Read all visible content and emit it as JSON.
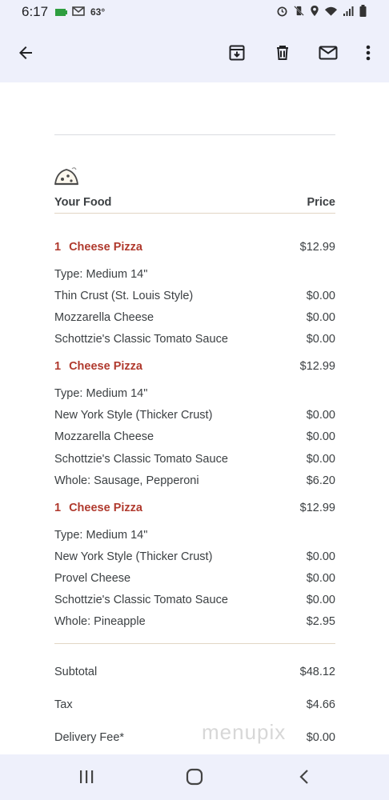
{
  "status_bar": {
    "time": "6:17",
    "temperature": "63°",
    "left_icons": [
      "battery-saver-icon",
      "mail-notification-icon"
    ],
    "right_icons": [
      "alarm-icon",
      "vibrate-off-icon",
      "location-icon",
      "wifi-icon",
      "signal-icon",
      "battery-icon"
    ]
  },
  "app_bar": {
    "actions": [
      "back-arrow-icon",
      "archive-icon",
      "delete-icon",
      "mark-unread-icon",
      "more-vert-icon"
    ]
  },
  "receipt": {
    "header": {
      "food_label": "Your Food",
      "price_label": "Price"
    },
    "items": [
      {
        "qty": "1",
        "name": "Cheese Pizza",
        "price": "$12.99",
        "type": "Type: Medium 14\"",
        "options": [
          {
            "label": "Thin Crust (St. Louis Style)",
            "price": "$0.00"
          },
          {
            "label": "Mozzarella Cheese",
            "price": "$0.00"
          },
          {
            "label": "Schottzie's Classic Tomato Sauce",
            "price": "$0.00"
          }
        ]
      },
      {
        "qty": "1",
        "name": "Cheese Pizza",
        "price": "$12.99",
        "type": "Type: Medium 14\"",
        "options": [
          {
            "label": "New York Style (Thicker Crust)",
            "price": "$0.00"
          },
          {
            "label": "Mozzarella Cheese",
            "price": "$0.00"
          },
          {
            "label": "Schottzie's Classic Tomato Sauce",
            "price": "$0.00"
          },
          {
            "label": "Whole: Sausage, Pepperoni",
            "price": "$6.20"
          }
        ]
      },
      {
        "qty": "1",
        "name": "Cheese Pizza",
        "price": "$12.99",
        "type": "Type: Medium 14\"",
        "options": [
          {
            "label": "New York Style (Thicker Crust)",
            "price": "$0.00"
          },
          {
            "label": "Provel Cheese",
            "price": "$0.00"
          },
          {
            "label": "Schottzie's Classic Tomato Sauce",
            "price": "$0.00"
          },
          {
            "label": "Whole: Pineapple",
            "price": "$2.95"
          }
        ]
      }
    ],
    "totals": [
      {
        "label": "Subtotal",
        "value": "$48.12"
      },
      {
        "label": "Tax",
        "value": "$4.66"
      },
      {
        "label": "Delivery Fee*",
        "value": "$0.00"
      }
    ]
  },
  "watermark": "menupix",
  "nav_bar": {
    "buttons": [
      "recent-apps-icon",
      "home-icon",
      "back-icon"
    ]
  },
  "colors": {
    "accent_red": "#b03a2e",
    "chrome": "#eef0fb"
  }
}
